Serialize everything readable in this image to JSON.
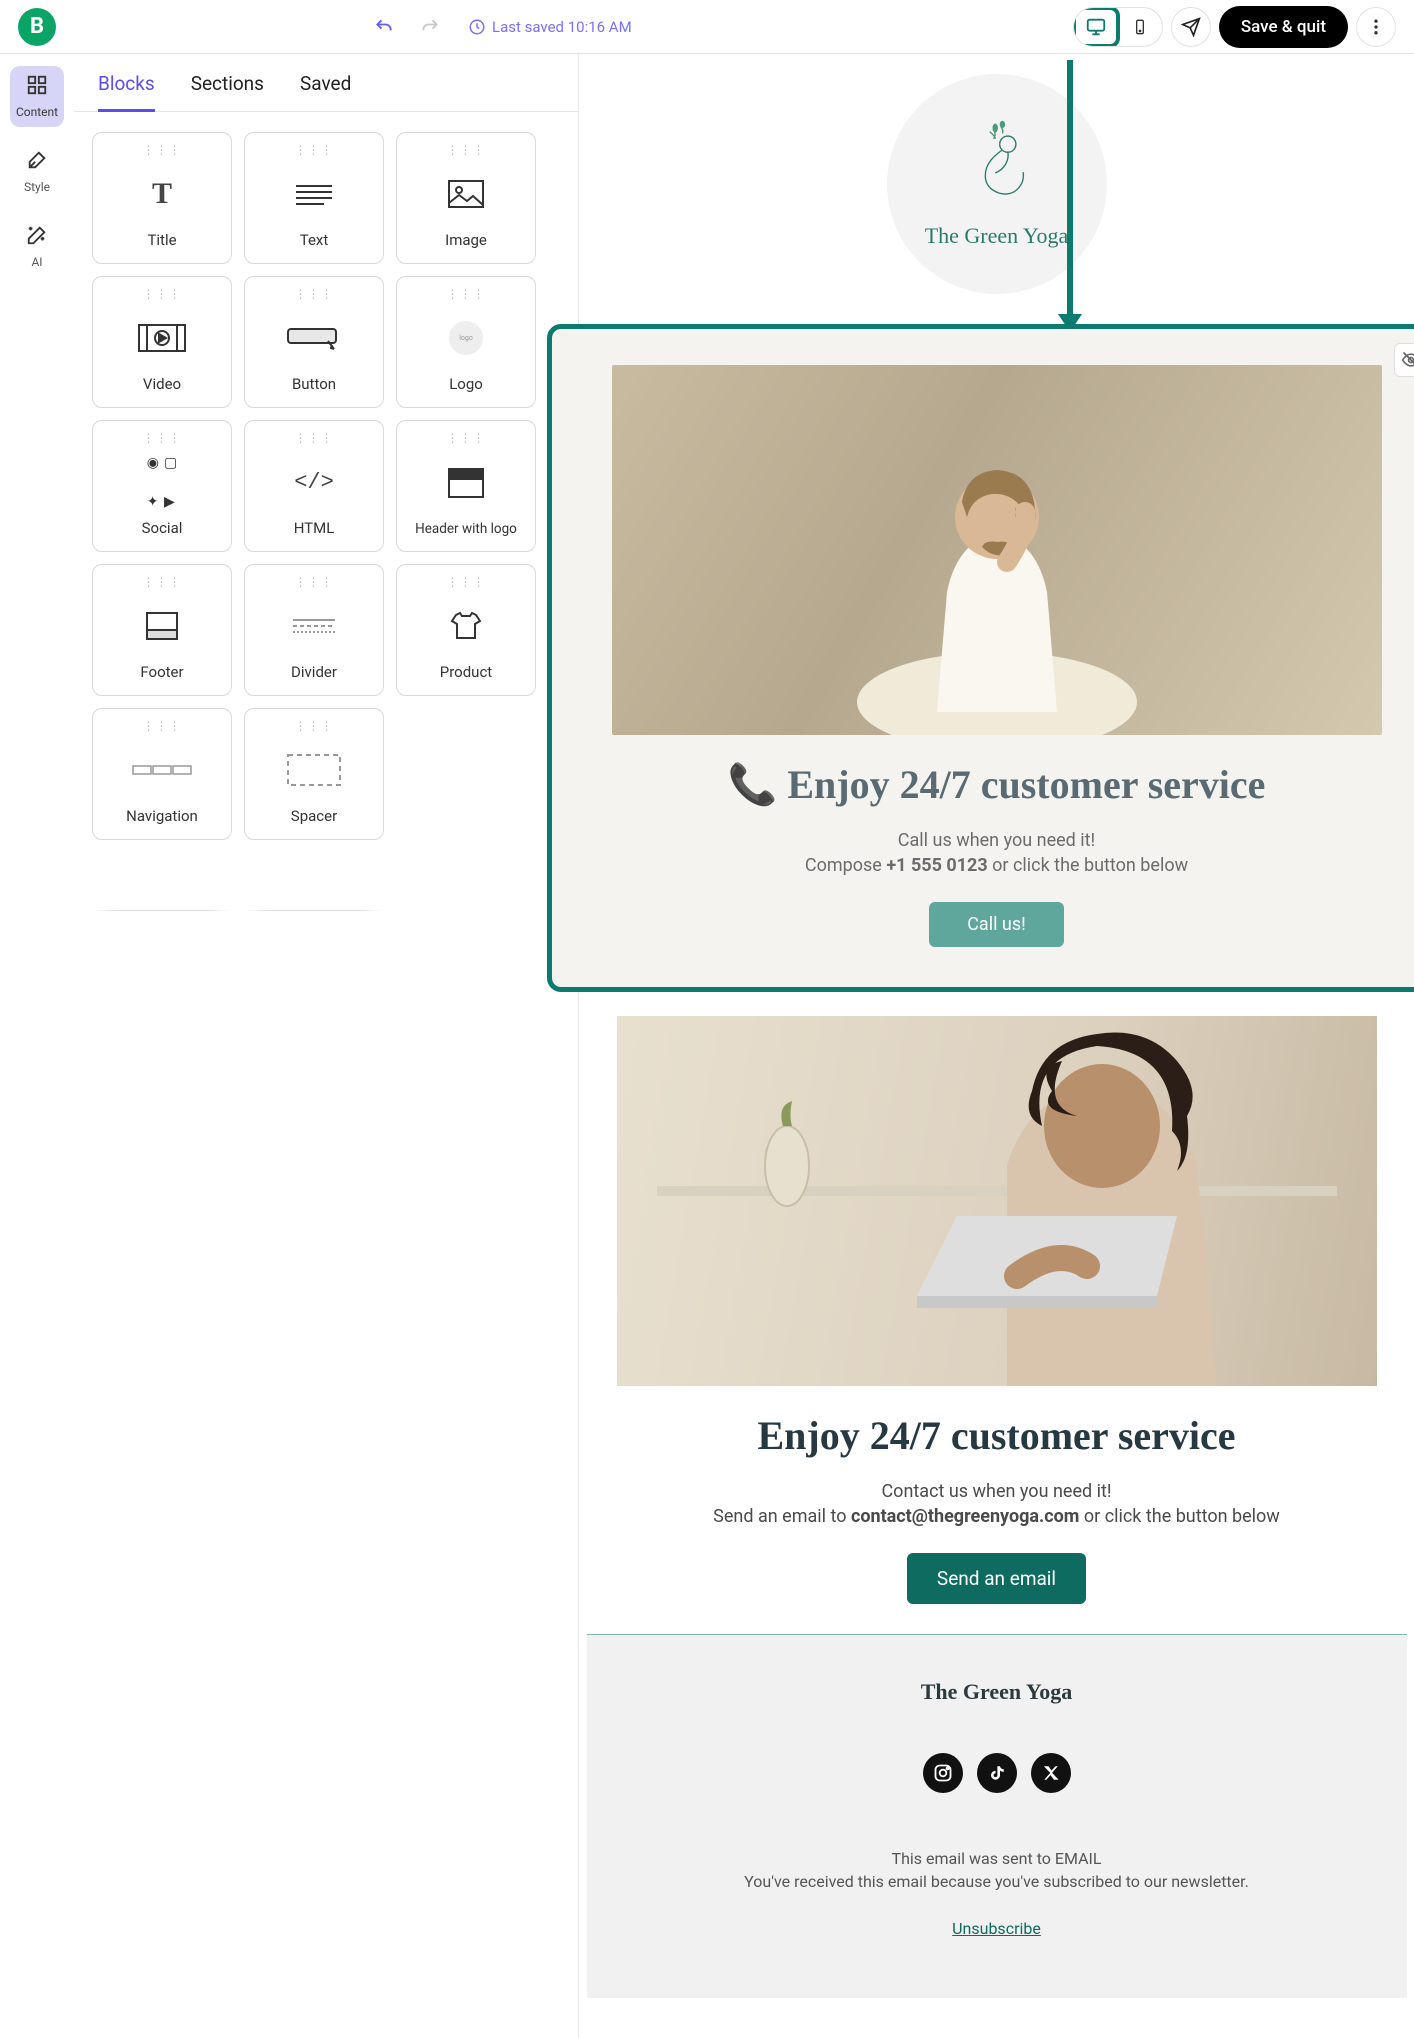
{
  "toolbar": {
    "last_saved": "Last saved 10:16 AM",
    "save_quit": "Save & quit"
  },
  "rail": {
    "content": "Content",
    "style": "Style",
    "ai": "AI"
  },
  "tabs": {
    "blocks": "Blocks",
    "sections": "Sections",
    "saved": "Saved"
  },
  "blocks": [
    "Title",
    "Text",
    "Image",
    "Video",
    "Button",
    "Logo",
    "Social",
    "HTML",
    "Header with logo",
    "Footer",
    "Divider",
    "Product",
    "Navigation",
    "Spacer"
  ],
  "brand": {
    "name": "The Green Yoga"
  },
  "section1": {
    "title_emoji": "📞",
    "title": "Enjoy 24/7 customer service",
    "line1": "Call us when you need it!",
    "line2a": "Compose ",
    "phone": "+1 555 0123",
    "line2b": " or click the button below",
    "cta": "Call us!"
  },
  "section2": {
    "title": "Enjoy 24/7 customer service",
    "line1": "Contact us when you need it!",
    "line2a": "Send an email to ",
    "email": "contact@thegreenyoga.com",
    "line2b": " or click the button below",
    "cta": "Send an email"
  },
  "footer": {
    "brand": "The Green Yoga",
    "sent_to_a": "This email was sent to ",
    "sent_to_b": "EMAIL",
    "reason": "You've received this email because you've subscribed to our newsletter.",
    "unsub": "Unsubscribe"
  }
}
